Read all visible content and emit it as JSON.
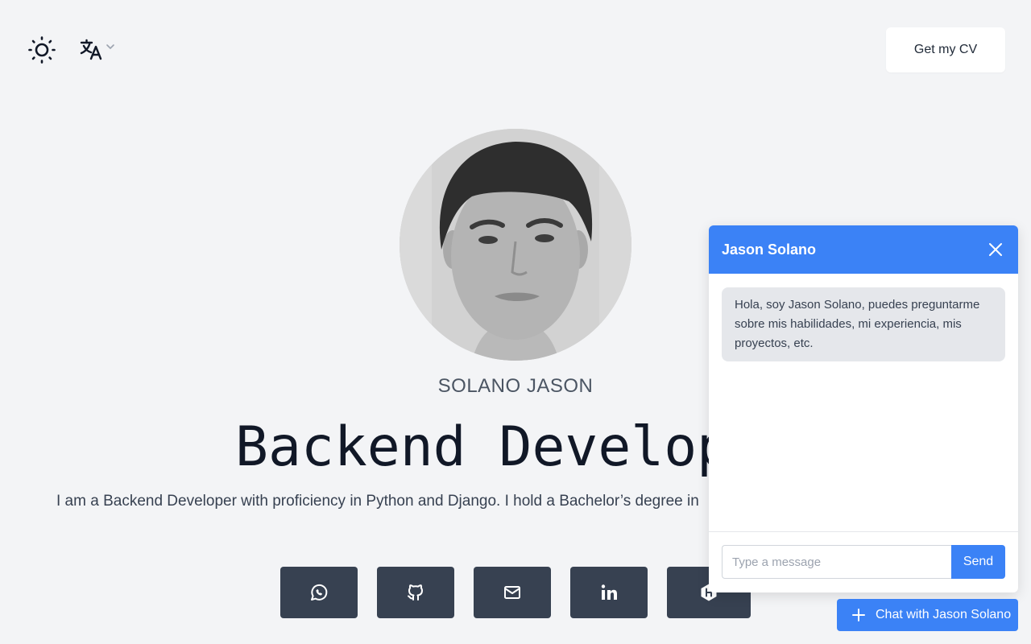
{
  "header": {
    "theme_icon": "sun-icon",
    "language_icon": "translate-icon",
    "cv_button_label": "Get my CV"
  },
  "hero": {
    "name": "SOLANO JASON",
    "role": "Backend Developer",
    "bio": "I am a Backend Developer with proficiency in Python and Django. I hold a Bachelor’s degree in"
  },
  "socials": [
    {
      "icon": "whatsapp-icon"
    },
    {
      "icon": "github-icon"
    },
    {
      "icon": "mail-icon"
    },
    {
      "icon": "linkedin-icon"
    },
    {
      "icon": "hackerrank-icon"
    }
  ],
  "chat": {
    "title": "Jason Solano",
    "welcome_message": "Hola, soy Jason Solano, puedes preguntarme sobre mis habilidades, mi experiencia, mis proyectos, etc.",
    "input_placeholder": "Type a message",
    "send_label": "Send",
    "launcher_label": "Chat with Jason Solano"
  },
  "colors": {
    "background": "#f3f4f6",
    "accent": "#3b82f6",
    "social_button": "#374151"
  }
}
